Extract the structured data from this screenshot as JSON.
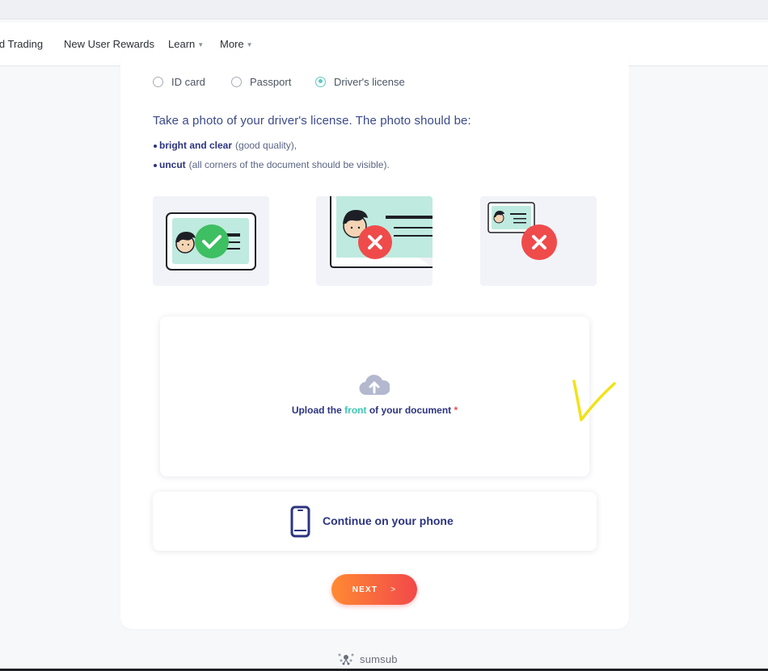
{
  "nav": {
    "items": [
      {
        "label": "id Trading",
        "has_caret": false
      },
      {
        "label": "New User Rewards",
        "has_caret": false
      },
      {
        "label": "Learn",
        "has_caret": true
      },
      {
        "label": "More",
        "has_caret": true
      }
    ]
  },
  "doc_type": {
    "options": [
      "ID card",
      "Passport",
      "Driver's license"
    ],
    "selected": "Driver's license"
  },
  "instructions": {
    "heading": "Take a photo of your driver's license. The photo should be:",
    "bullets": [
      {
        "bold": "bright and clear",
        "rest": "(good quality),"
      },
      {
        "bold": "uncut",
        "rest": "(all corners of the document should be visible)."
      }
    ]
  },
  "examples": [
    {
      "icon": "check-icon",
      "status": "good"
    },
    {
      "icon": "cross-icon",
      "status": "cropped"
    },
    {
      "icon": "cross-icon",
      "status": "too-small"
    }
  ],
  "upload": {
    "prefix": "Upload the",
    "accent": "front",
    "suffix": "of your document",
    "required_mark": "*",
    "icon": "cloud-upload-icon"
  },
  "phone": {
    "label": "Continue on your phone",
    "icon": "smartphone-icon"
  },
  "next_button": {
    "label": "NEXT",
    "arrow": ">"
  },
  "footer": {
    "brand": "sumsub"
  },
  "colors": {
    "accent_teal": "#3ec7b5",
    "navy": "#2c3480",
    "error_red": "#ef4b4b",
    "success_green": "#3dbf62",
    "next_gradient_start": "#ff8a32",
    "next_gradient_end": "#f2484a",
    "annotation_yellow": "#f2e21a"
  }
}
